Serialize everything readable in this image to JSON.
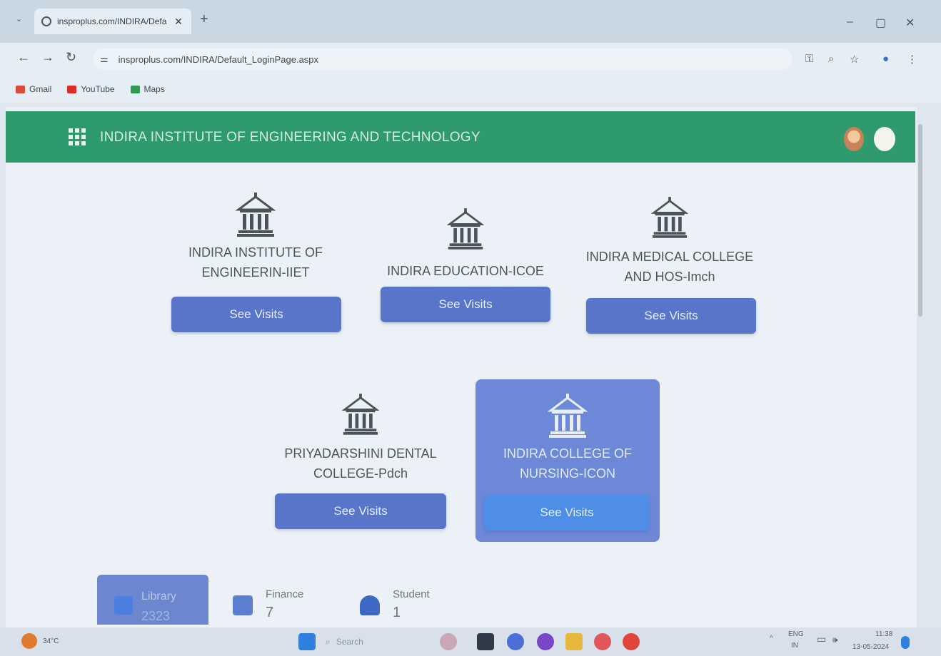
{
  "browser": {
    "tab_title": "insproplus.com/INDIRA/Defa",
    "url": "insproplus.com/INDIRA/Default_LoginPage.aspx",
    "bookmarks": [
      {
        "label": "Gmail",
        "color": "#d94b3b"
      },
      {
        "label": "YouTube",
        "color": "#e02b2b"
      },
      {
        "label": "Maps",
        "color": "#2e9b55"
      }
    ]
  },
  "app": {
    "title": "INDIRA INSTITUTE OF ENGINEERING AND TECHNOLOGY",
    "accent": "#2f9a6c",
    "button_color": "#5975c9"
  },
  "institutions": [
    {
      "name_line1": "INDIRA INSTITUTE OF",
      "name_line2": "ENGINEERIN-IIET",
      "button": "See Visits"
    },
    {
      "name_line1": "INDIRA EDUCATION-ICOE",
      "name_line2": "",
      "button": "See Visits"
    },
    {
      "name_line1": "INDIRA MEDICAL COLLEGE",
      "name_line2": "AND HOS-Imch",
      "button": "See Visits"
    },
    {
      "name_line1": "PRIYADARSHINI DENTAL",
      "name_line2": "COLLEGE-Pdch",
      "button": "See Visits"
    },
    {
      "name_line1": "INDIRA COLLEGE OF",
      "name_line2": "NURSING-ICON",
      "button": "See Visits",
      "selected": true
    }
  ],
  "stats": [
    {
      "label": "Library",
      "value": "2323"
    },
    {
      "label": "Finance",
      "value": "7"
    },
    {
      "label": "Student",
      "value": "1"
    }
  ],
  "taskbar": {
    "weather": "34°C",
    "search": "Search",
    "lang": "ENG",
    "region": "IN",
    "time": "11:38",
    "date": "13-05-2024"
  }
}
